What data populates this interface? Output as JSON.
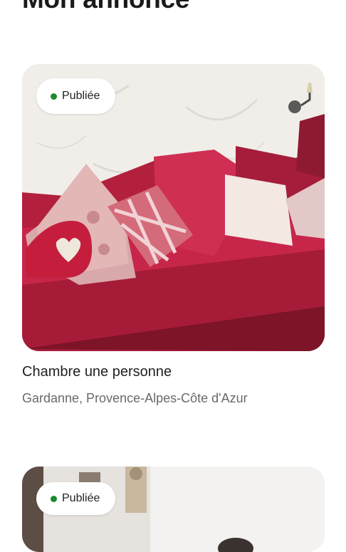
{
  "page": {
    "title": "Mon annonce"
  },
  "listings": [
    {
      "status": "Publiée",
      "status_color": "#1a8a2c",
      "title": "Chambre une personne",
      "location": "Gardanne, Provence-Alpes-Côte d'Azur"
    },
    {
      "status": "Publiée",
      "status_color": "#1a8a2c"
    }
  ],
  "colors": {
    "background": "#ffffff",
    "title_text": "#1a1a1a",
    "secondary_text": "#6a6a6a"
  }
}
